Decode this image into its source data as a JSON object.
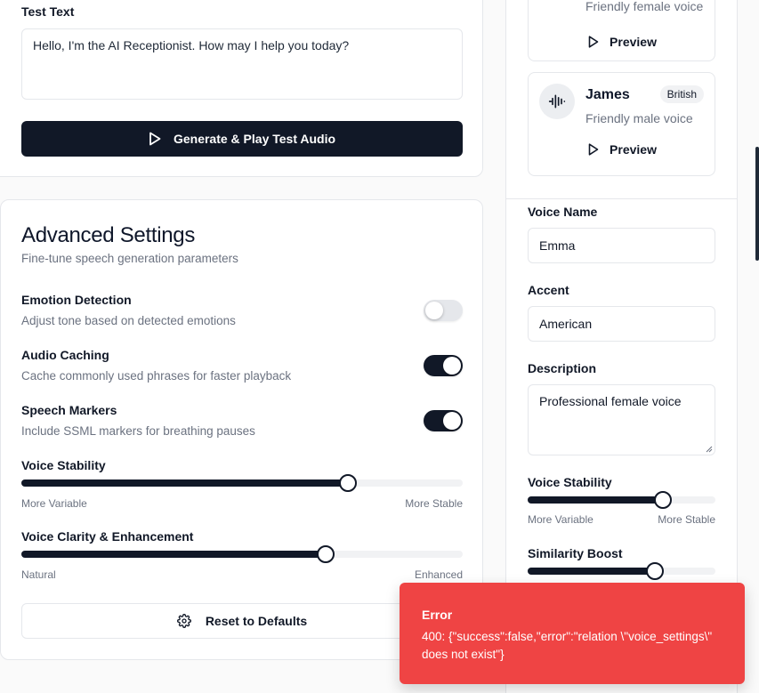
{
  "test_section": {
    "label": "Test Text",
    "text_value": "Hello, I'm the AI Receptionist. How may I help you today?",
    "generate_label": "Generate & Play Test Audio"
  },
  "advanced": {
    "title": "Advanced Settings",
    "subtitle": "Fine-tune speech generation parameters",
    "toggles": [
      {
        "label": "Emotion Detection",
        "desc": "Adjust tone based on detected emotions",
        "on": false
      },
      {
        "label": "Audio Caching",
        "desc": "Cache commonly used phrases for faster playback",
        "on": true
      },
      {
        "label": "Speech Markers",
        "desc": "Include SSML markers for breathing pauses",
        "on": true
      }
    ],
    "sliders": [
      {
        "label": "Voice Stability",
        "min_label": "More Variable",
        "max_label": "More Stable",
        "value": 0.74
      },
      {
        "label": "Voice Clarity & Enhancement",
        "min_label": "Natural",
        "max_label": "Enhanced",
        "value": 0.69
      }
    ],
    "reset_label": "Reset to Defaults"
  },
  "voices": {
    "prev_desc": "Friendly female voice",
    "prev_preview": "Preview",
    "james": {
      "name": "James",
      "accent": "British",
      "desc": "Friendly male voice",
      "preview": "Preview"
    }
  },
  "form": {
    "voice_name_label": "Voice Name",
    "voice_name_value": "Emma",
    "accent_label": "Accent",
    "accent_value": "American",
    "description_label": "Description",
    "description_value": "Professional female voice",
    "stability": {
      "label": "Voice Stability",
      "min_label": "More Variable",
      "max_label": "More Stable",
      "value": 0.72
    },
    "similarity": {
      "label": "Similarity Boost",
      "value": 0.68
    }
  },
  "toast": {
    "title": "Error",
    "message": "400: {\"success\":false,\"error\":\"relation \\\"voice_settings\\\" does not exist\"}"
  },
  "colors": {
    "primary": "#111827",
    "error": "#ef4444",
    "border": "#e5e7eb"
  }
}
